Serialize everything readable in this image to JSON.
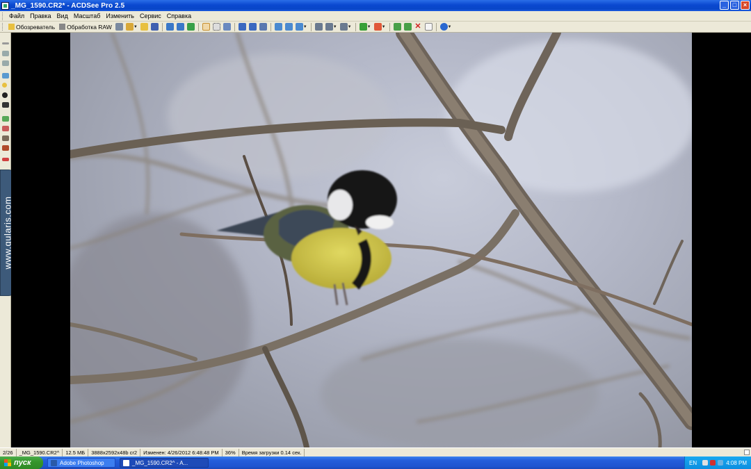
{
  "window": {
    "title": "_MG_1590.CR2* - ACDSee Pro 2.5",
    "buttons": {
      "minimize": "_",
      "maximize": "□",
      "close": "×"
    }
  },
  "menu": [
    "Файл",
    "Правка",
    "Вид",
    "Масштаб",
    "Изменить",
    "Сервис",
    "Справка"
  ],
  "toolbar": {
    "browser_label": "Обозреватель",
    "raw_label": "Обработка RAW",
    "icons": [
      "save-icon",
      "rotate-left-icon",
      "rotate-right-icon",
      "zoom-in-icon",
      "zoom-out-icon",
      "delete-icon",
      "help-icon"
    ]
  },
  "watermark": "www.gularis.com",
  "status": {
    "position": "2/26",
    "filename": "_MG_1590.CR2^",
    "size": "12.5 МБ",
    "dimensions": "3888x2592x48b cr2",
    "modified": "Изменен: 4/26/2012 6:48:48 PM",
    "zoom": "36%",
    "load_time": "Время загрузки 0.14 сек."
  },
  "taskbar": {
    "start_label": "пуск",
    "tasks": [
      {
        "label": "Adobe Photoshop",
        "active": false
      },
      {
        "label": "_MG_1590.CR2^ - A...",
        "active": true
      }
    ],
    "language": "EN",
    "clock": "4:08 PM"
  },
  "colors": {
    "titlebar": "#0a48d0",
    "chrome": "#ece9d8",
    "start_button": "#36962c",
    "taskbar": "#245edb"
  }
}
